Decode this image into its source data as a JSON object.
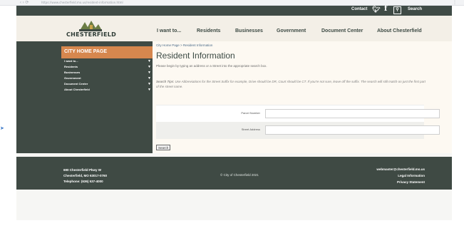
{
  "colors": {
    "dark_green": "#3f4a44",
    "orange": "#d6874e",
    "cream": "#fdf9f2",
    "link_blue": "#4a6a88"
  },
  "browser": {
    "url": "https://www.chesterfield.mo.us/resident-information.html"
  },
  "utility": {
    "contact": "Contact",
    "twitter_icon": "twitter-icon",
    "facebook_icon": "facebook-icon",
    "search_icon": "search-icon",
    "search": "Search"
  },
  "logo": {
    "text": "CHESTERFIELD"
  },
  "nav": {
    "i_want_to": "I want to...",
    "residents": "Residents",
    "businesses": "Businesses",
    "government": "Government",
    "document_center": "Document Center",
    "about": "About Chesterfield"
  },
  "sidebar": {
    "title": "CITY HOME PAGE",
    "items": [
      {
        "label": "I want to..."
      },
      {
        "label": "Residents"
      },
      {
        "label": "Businesses"
      },
      {
        "label": "Government"
      },
      {
        "label": "Document Center"
      },
      {
        "label": "About Chesterfield"
      }
    ]
  },
  "breadcrumb": "City Home Page > Resident Information",
  "page": {
    "title": "Resident Information",
    "intro": "Please begin by typing an address or a Street into the appropriate search box.",
    "tips_label": "Search Tips:",
    "tips_text": "Use Abbreviations for the Street Suffix for example, Drive should be DR, Court should be CT. If you're not sure, leave off the suffix. The search will still match on just the first part of the street name."
  },
  "form": {
    "parcel_label": "Parcel Number",
    "street_label": "Street Address",
    "parcel_value": "",
    "street_value": "",
    "search_button": "Search"
  },
  "footer": {
    "address_line1": "690 Chesterfield Pkwy W",
    "address_line2": "Chesterfield, MO 63017-0760",
    "address_line3": "Telephone: (636) 537-4000",
    "copyright": "© City of Chesterfield 2021",
    "webmaster": "webmaster@chesterfield.mo.us",
    "legal": "Legal Information",
    "privacy": "Privacy Statement"
  }
}
